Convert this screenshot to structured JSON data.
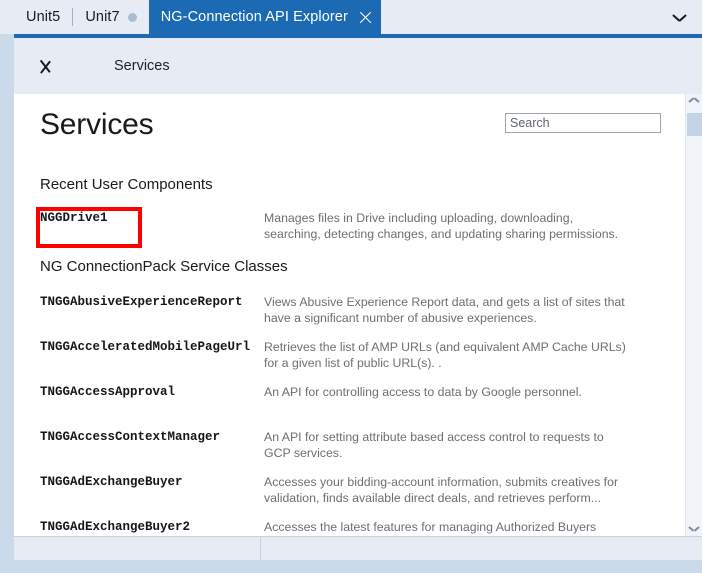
{
  "window": {
    "frame_color": "#cbdaeb",
    "accent_color": "#1b6ab3",
    "annotation_color": "#fe0000"
  },
  "tabs": {
    "items": [
      {
        "label": "Unit5",
        "active": false,
        "modified": false
      },
      {
        "label": "Unit7",
        "active": false,
        "modified": true
      },
      {
        "label": "NG-Connection API Explorer",
        "active": true,
        "modified": false,
        "closable": true
      }
    ],
    "overflow_icon": "chevron-down-icon"
  },
  "header": {
    "back_icon": "chevron-left-icon",
    "breadcrumb": "Services"
  },
  "main": {
    "title": "Services",
    "search": {
      "placeholder": "Search",
      "value": ""
    },
    "sections": [
      {
        "heading": "Recent User Components",
        "rows": [
          {
            "name": "NGGDrive1",
            "desc": "Manages files in Drive including uploading, downloading, searching, detecting changes, and updating sharing permissions.",
            "highlighted": true
          }
        ]
      },
      {
        "heading": "NG ConnectionPack Service Classes",
        "rows": [
          {
            "name": "TNGGAbusiveExperienceReport",
            "desc": "Views Abusive Experience Report data, and gets a list of sites that have a significant number of abusive experiences."
          },
          {
            "name": "TNGGAcceleratedMobilePageUrl",
            "desc": "Retrieves the list of AMP URLs (and equivalent AMP Cache URLs) for a given list of public URL(s). ."
          },
          {
            "name": "TNGGAccessApproval",
            "desc": "An API for controlling access to data by Google personnel."
          },
          {
            "name": "TNGGAccessContextManager",
            "desc": "An API for setting attribute based access control to requests to GCP services."
          },
          {
            "name": "TNGGAdExchangeBuyer",
            "desc": "Accesses your bidding-account information, submits creatives for validation, finds available direct deals, and retrieves perform..."
          },
          {
            "name": "TNGGAdExchangeBuyer2",
            "desc": "Accesses the latest features for managing Authorized Buyers accounts, Real-Time Bidding configurations and auction metric..."
          }
        ]
      }
    ]
  },
  "scrollbar": {
    "up_icon": "scroll-up-arrow-icon",
    "down_icon": "scroll-down-arrow-icon"
  },
  "statusbar": {
    "left_text": "",
    "right_text": ""
  }
}
